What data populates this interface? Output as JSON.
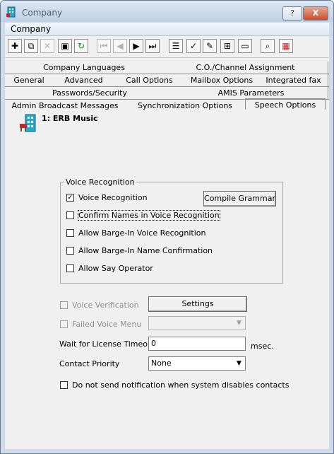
{
  "window": {
    "title": "Company",
    "help_label": "?",
    "close_label": "X"
  },
  "menu": {
    "items": [
      {
        "label": "Company"
      }
    ]
  },
  "tabs": {
    "row1": [
      "Company Languages",
      "C.O./Channel Assignment"
    ],
    "row2": [
      "General",
      "Advanced",
      "Call Options",
      "Mailbox Options",
      "Integrated fax"
    ],
    "row3": [
      "Passwords/Security",
      "AMIS Parameters"
    ],
    "row4": [
      "Admin Broadcast Messages",
      "Synchronization Options",
      "Speech Options"
    ]
  },
  "entity": {
    "title": "1: ERB Music"
  },
  "voice_group": {
    "label": "Voice Recognition",
    "options": [
      {
        "label": "Voice Recognition",
        "checked": true
      },
      {
        "label": "Confirm Names in Voice Recognition",
        "checked": false
      },
      {
        "label": "Allow Barge-In Voice Recognition",
        "checked": false
      },
      {
        "label": "Allow Barge-In Name Confirmation",
        "checked": false
      },
      {
        "label": "Allow Say Operator",
        "checked": false
      }
    ],
    "compile_button": "Compile Grammar"
  },
  "voice_verification": {
    "label": "Voice Verification",
    "button": "Settings"
  },
  "failed_voice_menu": {
    "label": "Failed Voice Menu",
    "value": ""
  },
  "license_timeout": {
    "label": "Wait for License Timeout",
    "value": "0",
    "unit": "msec."
  },
  "contact_priority": {
    "label": "Contact Priority",
    "value": "None"
  },
  "notification": {
    "label": "Do not send notification when system disables contacts"
  }
}
